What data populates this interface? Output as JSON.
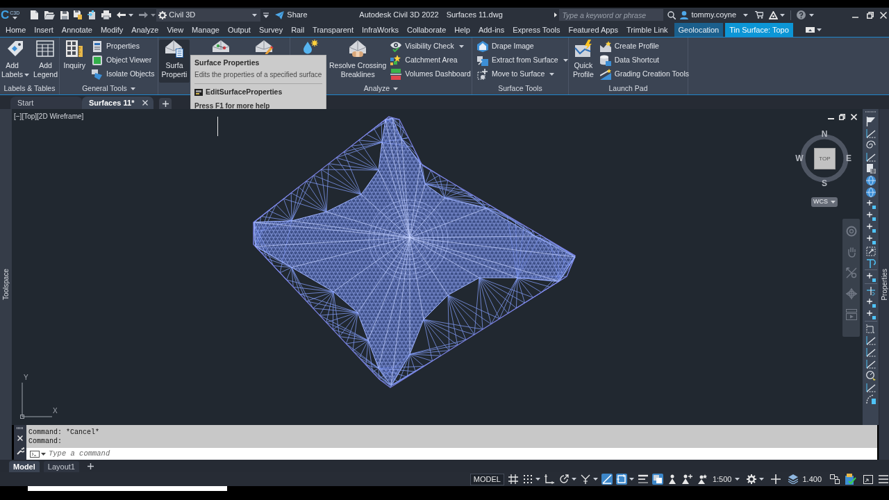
{
  "title_bar": {
    "logo": "C",
    "logo_badge": "C3D",
    "workspace": "Civil 3D",
    "share": "Share",
    "app_title": "Autodesk Civil 3D 2022",
    "file_name": "Surfaces 11.dwg",
    "search": {
      "placeholder": "Type a keyword or phrase"
    },
    "user": "tommy.coyne"
  },
  "ribbon_tabs": [
    {
      "label": "Home",
      "selected": false,
      "kind": "standard"
    },
    {
      "label": "Insert",
      "selected": false,
      "kind": "standard"
    },
    {
      "label": "Annotate",
      "selected": false,
      "kind": "standard"
    },
    {
      "label": "Modify",
      "selected": false,
      "kind": "standard"
    },
    {
      "label": "Analyze",
      "selected": false,
      "kind": "standard"
    },
    {
      "label": "View",
      "selected": false,
      "kind": "standard"
    },
    {
      "label": "Manage",
      "selected": false,
      "kind": "standard"
    },
    {
      "label": "Output",
      "selected": false,
      "kind": "standard"
    },
    {
      "label": "Survey",
      "selected": false,
      "kind": "standard"
    },
    {
      "label": "Rail",
      "selected": false,
      "kind": "standard"
    },
    {
      "label": "Transparent",
      "selected": false,
      "kind": "standard"
    },
    {
      "label": "InfraWorks",
      "selected": false,
      "kind": "standard"
    },
    {
      "label": "Collaborate",
      "selected": false,
      "kind": "standard"
    },
    {
      "label": "Help",
      "selected": false,
      "kind": "standard"
    },
    {
      "label": "Add-ins",
      "selected": false,
      "kind": "standard"
    },
    {
      "label": "Express Tools",
      "selected": false,
      "kind": "standard"
    },
    {
      "label": "Featured Apps",
      "selected": false,
      "kind": "standard"
    },
    {
      "label": "Trimble Link",
      "selected": false,
      "kind": "standard"
    },
    {
      "label": "Geolocation",
      "selected": false,
      "kind": "contextual"
    },
    {
      "label": "Tin Surface: Topo",
      "selected": true,
      "kind": "contextual"
    }
  ],
  "ribbon_panels": [
    {
      "title": "Labels & Tables",
      "expandable": false,
      "items": [
        {
          "kind": "large",
          "label": "Add\nLabels",
          "dropdown": true,
          "highlighted": false
        },
        {
          "kind": "large",
          "label": "Add\nLegend",
          "dropdown": false,
          "highlighted": false
        }
      ]
    },
    {
      "title": "General Tools",
      "expandable": true,
      "items": [
        {
          "kind": "large",
          "label": "Inquiry",
          "dropdown": false,
          "highlighted": false
        },
        {
          "kind": "small",
          "label": "Properties",
          "dropdown": false,
          "highlighted": false
        },
        {
          "kind": "small",
          "label": "Object Viewer",
          "dropdown": false,
          "highlighted": false
        },
        {
          "kind": "small",
          "label": "Isolate Objects",
          "dropdown": false,
          "highlighted": false
        }
      ]
    },
    {
      "items": [
        {
          "kind": "large",
          "label": "Surfa\nProperti",
          "dropdown": false,
          "highlighted": true
        },
        {
          "kind": "large",
          "dropdown": false,
          "highlighted": false
        },
        {
          "kind": "large",
          "dropdown": false,
          "highlighted": false
        }
      ]
    },
    {
      "title": "Analyze",
      "expandable": true,
      "items": [
        {
          "kind": "large",
          "dropdown": false,
          "highlighted": false
        },
        {
          "kind": "large",
          "label": "Resolve Crossing\nBreaklines",
          "dropdown": false,
          "highlighted": false
        },
        {
          "kind": "small",
          "label": "Visibility Check",
          "dropdown": true,
          "highlighted": false
        },
        {
          "kind": "small",
          "label": "Catchment Area",
          "dropdown": false,
          "highlighted": false
        },
        {
          "kind": "small",
          "label": "Volumes Dashboard",
          "dropdown": false,
          "highlighted": false
        }
      ]
    },
    {
      "title": "Surface Tools",
      "expandable": false,
      "items": [
        {
          "kind": "small",
          "label": "Drape Image",
          "dropdown": false,
          "highlighted": false
        },
        {
          "kind": "small",
          "label": "Extract from Surface",
          "dropdown": true,
          "highlighted": false
        },
        {
          "kind": "small",
          "label": "Move to Surface",
          "dropdown": true,
          "highlighted": false
        }
      ]
    },
    {
      "title": "Launch Pad",
      "expandable": false,
      "items": [
        {
          "kind": "large",
          "label": "Quick\nProfile",
          "dropdown": false,
          "highlighted": false
        },
        {
          "kind": "small",
          "label": "Create Profile",
          "dropdown": false,
          "highlighted": false
        },
        {
          "kind": "small",
          "label": "Data Shortcut",
          "dropdown": false,
          "highlighted": false
        },
        {
          "kind": "small",
          "label": "Grading Creation Tools",
          "dropdown": false,
          "highlighted": false
        }
      ]
    }
  ],
  "tooltip": {
    "title": "Surface Properties",
    "description": "Edits the properties of a specified surface",
    "command": "EditSurfaceProperties",
    "help": "Press F1 for more help"
  },
  "document_tabs": [
    {
      "label": "Start",
      "selected": false
    },
    {
      "label": "Surfaces 11*",
      "selected": true
    }
  ],
  "side_palettes": {
    "left": "Toolspace",
    "right": "Properties"
  },
  "viewport": {
    "label": "[−][Top][2D Wireframe]",
    "view_cube": {
      "north": "N",
      "east": "E",
      "south": "S",
      "west": "W",
      "face": "TOP",
      "coordinate_system": "WCS"
    },
    "ucs_icon": {
      "x_axis": "X",
      "y_axis": "Y"
    }
  },
  "command_line": {
    "history": [
      "Command: *Cancel*",
      "Command:"
    ],
    "placeholder": "Type a command"
  },
  "layout_tabs": [
    {
      "label": "Model",
      "selected": true
    },
    {
      "label": "Layout1",
      "selected": false
    }
  ],
  "status_bar": {
    "space": "MODEL",
    "toggles": [
      {
        "on": false,
        "dropdown": false
      },
      {
        "on": false,
        "dropdown": true
      },
      {
        "on": false,
        "dropdown": false
      },
      {
        "on": false,
        "dropdown": true
      },
      {
        "on": false,
        "dropdown": true
      },
      {
        "on": true,
        "dropdown": false
      },
      {
        "on": true,
        "dropdown": true
      },
      {
        "on": false,
        "dropdown": false
      },
      {
        "on": true,
        "dropdown": false
      },
      {
        "on": false,
        "dropdown": false
      },
      {
        "on": false,
        "dropdown": false
      },
      {
        "on": false,
        "dropdown": false
      }
    ],
    "annotation_scale": "1:500",
    "value": "1.400"
  }
}
